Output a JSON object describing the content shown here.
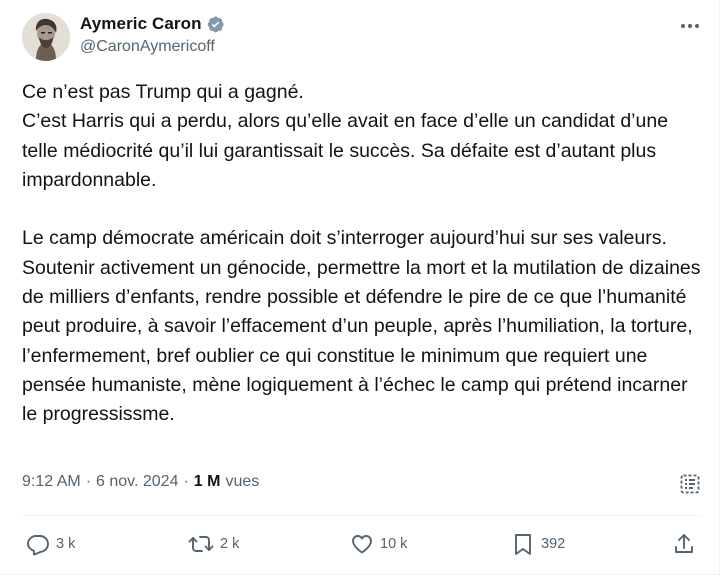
{
  "author": {
    "display_name": "Aymeric Caron",
    "handle": "@CaronAymericoff",
    "verified": true
  },
  "tweet": {
    "text": "Ce n’est pas Trump qui a gagné.\nC’est Harris qui a perdu, alors qu’elle avait en face d’elle un candidat d’une telle médiocrité qu’il lui garantissait le succès. Sa défaite est d’autant plus impardonnable.\n\nLe camp démocrate américain doit s’interroger aujourd’hui sur ses valeurs.\nSoutenir activement un génocide, permettre la mort et la mutilation de dizaines de milliers d’enfants, rendre possible et défendre le pire de ce que l’humanité peut produire, à savoir l’effacement d’un peuple, après l’humiliation, la torture, l’enfermement, bref oublier ce qui constitue le minimum que requiert une pensée humaniste, mène logiquement à l’échec le camp qui prétend incarner le progressissme."
  },
  "meta": {
    "time": "9:12 AM",
    "separator": "·",
    "date": "6 nov. 2024",
    "views_count": "1 M",
    "views_label": "vues"
  },
  "actions": {
    "reply_count": "3 k",
    "retweet_count": "2 k",
    "like_count": "10 k",
    "bookmark_count": "392"
  },
  "icons": {
    "more": "more-horizontal-icon",
    "verified": "verified-badge-icon",
    "analytics": "analytics-icon",
    "reply": "reply-icon",
    "retweet": "retweet-icon",
    "like": "heart-icon",
    "bookmark": "bookmark-icon",
    "share": "share-icon"
  },
  "colors": {
    "text": "#0f1419",
    "secondary": "#536471",
    "verified": "#829aab",
    "divider": "#eff3f4"
  }
}
